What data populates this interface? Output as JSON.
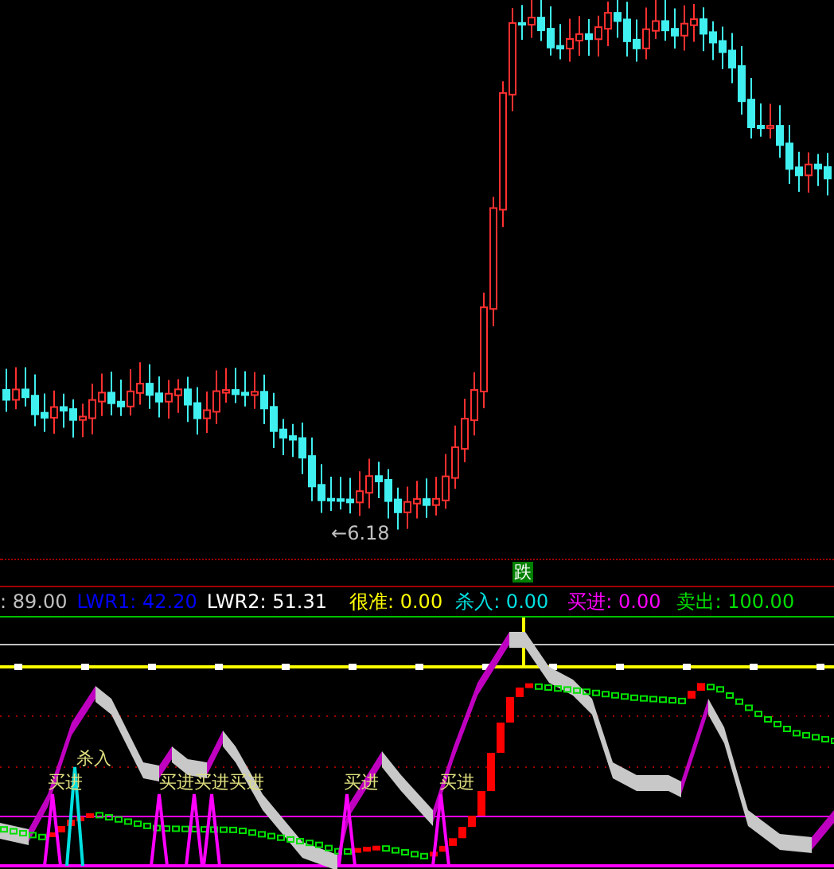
{
  "price_chart": {
    "low_marker": {
      "arrow": "←",
      "value": "6.18"
    }
  },
  "signal_badge": {
    "label": "跌"
  },
  "legend": [
    {
      "label": ": 89.00",
      "color": "#c0c0c0"
    },
    {
      "label": "LWR1: 42.20",
      "color": "#0000ff"
    },
    {
      "label": "LWR2: 51.31",
      "color": "#ffffff"
    },
    {
      "label": "很准: 0.00",
      "color": "#ffff00"
    },
    {
      "label": "杀入: 0.00",
      "color": "#00e0e0"
    },
    {
      "label": "买进: 0.00",
      "color": "#ff00ff"
    },
    {
      "label": "卖出: 100.00",
      "color": "#00e000"
    }
  ],
  "indicator": {
    "signals": [
      {
        "label": "杀入"
      },
      {
        "label": "买进"
      },
      {
        "label": "买进"
      },
      {
        "label": "买进"
      },
      {
        "label": "买进"
      },
      {
        "label": "买进"
      },
      {
        "label": "买进"
      }
    ]
  }
}
